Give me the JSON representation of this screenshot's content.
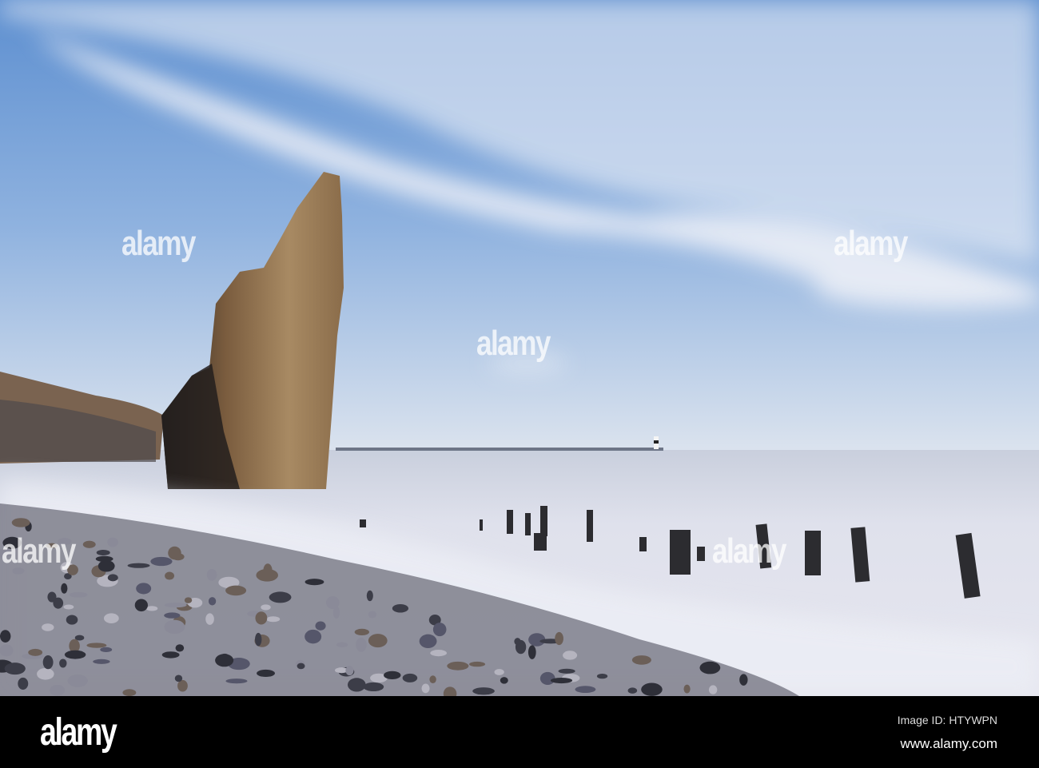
{
  "watermark": {
    "text": "alamy"
  },
  "footer": {
    "logo": "alamy",
    "image_id": "Image ID: HTYWPN",
    "url": "www.alamy.com"
  },
  "colors": {
    "sky_top": "#5d8fd0",
    "horizon": "#d9e2ee",
    "sea": "#dcdfeb",
    "rock": "#8a6a45",
    "footer": "#000000"
  }
}
